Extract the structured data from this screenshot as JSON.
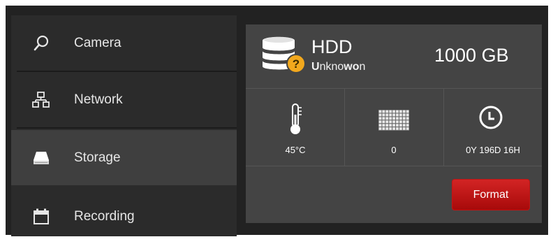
{
  "sidebar": {
    "items": [
      {
        "label": "Camera",
        "icon": "search-icon"
      },
      {
        "label": "Network",
        "icon": "network-icon"
      },
      {
        "label": "Storage",
        "icon": "hdd-icon",
        "active": true
      },
      {
        "label": "Recording",
        "icon": "calendar-icon"
      }
    ]
  },
  "disk": {
    "type": "HDD",
    "status_bold_1": "U",
    "status_plain_1": "nkno",
    "status_bold_2": "wo",
    "status_plain_2": "n",
    "capacity": "1000 GB",
    "status_icon": "question-badge-icon"
  },
  "stats": {
    "temperature": "45°C",
    "bad_sectors": "0",
    "power_on_time": "0Y 196D 16H",
    "icons": [
      "thermometer-icon",
      "grid-icon",
      "clock-icon"
    ]
  },
  "actions": {
    "format_label": "Format"
  },
  "colors": {
    "accent_button": "#c01515",
    "badge": "#f2a81d"
  }
}
